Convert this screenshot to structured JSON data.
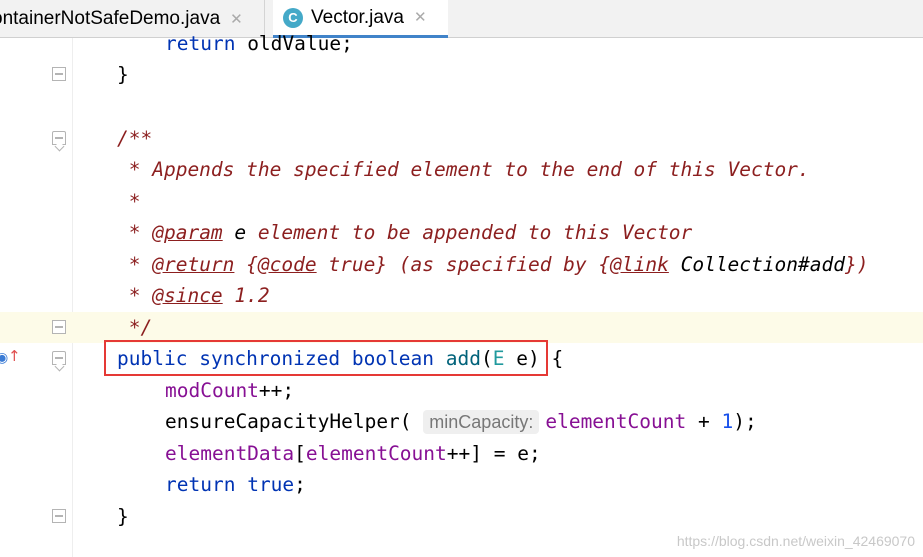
{
  "tabs": [
    {
      "label": "ContainerNotSafeDemo.java",
      "display": "ontainerNotSafeDemo.java",
      "close": "✕",
      "active": false
    },
    {
      "label": "Vector.java",
      "icon": "C",
      "close": "✕",
      "active": true
    }
  ],
  "code": {
    "line1": {
      "kw": "return",
      "rest": " oldValue;"
    },
    "line2": "}",
    "line3": "/**",
    "line4": " * Appends the specified element to the end of this Vector.",
    "line5": " *",
    "line6": {
      "prefix": " * ",
      "tag": "@param",
      "param": " e",
      "rest": " element to be appended to this Vector"
    },
    "line7": {
      "prefix": " * ",
      "tag": "@return",
      "sp": " ",
      "code_open": "{",
      "code_tag": "@code",
      "code_val": " true}",
      "middle": " (as specified by ",
      "link_open": "{",
      "link_tag": "@link",
      "link_ref": " Collection#add",
      "link_close": "})"
    },
    "line8": {
      "prefix": " * ",
      "tag": "@since",
      "rest": " 1.2"
    },
    "line9": " */",
    "line10": {
      "kw1": "public",
      "kw2": "synchronized",
      "kw3": "boolean",
      "name": "add",
      "open": "(",
      "type": "E",
      "param": " e",
      "close": ")",
      "brace": " {"
    },
    "line11": {
      "field": "modCount",
      "rest": "++;"
    },
    "line12": {
      "call": "ensureCapacityHelper(",
      "hint": "minCapacity:",
      "field": "elementCount",
      "plus": " + ",
      "num": "1",
      "end": ");"
    },
    "line13": {
      "field1": "elementData",
      "open": "[",
      "field2": "elementCount",
      "rest": "++] = e;"
    },
    "line14": {
      "kw1": "return",
      "kw2": "true",
      "end": ";"
    },
    "line15": "}"
  },
  "watermark": "https://blog.csdn.net/weixin_42469070",
  "colors": {
    "keyword": "#0033b3",
    "doc_comment": "#8c1f1f",
    "field": "#871094",
    "number": "#1750eb",
    "highlight_box": "#e53935",
    "active_tab_underline": "#4083c9"
  }
}
